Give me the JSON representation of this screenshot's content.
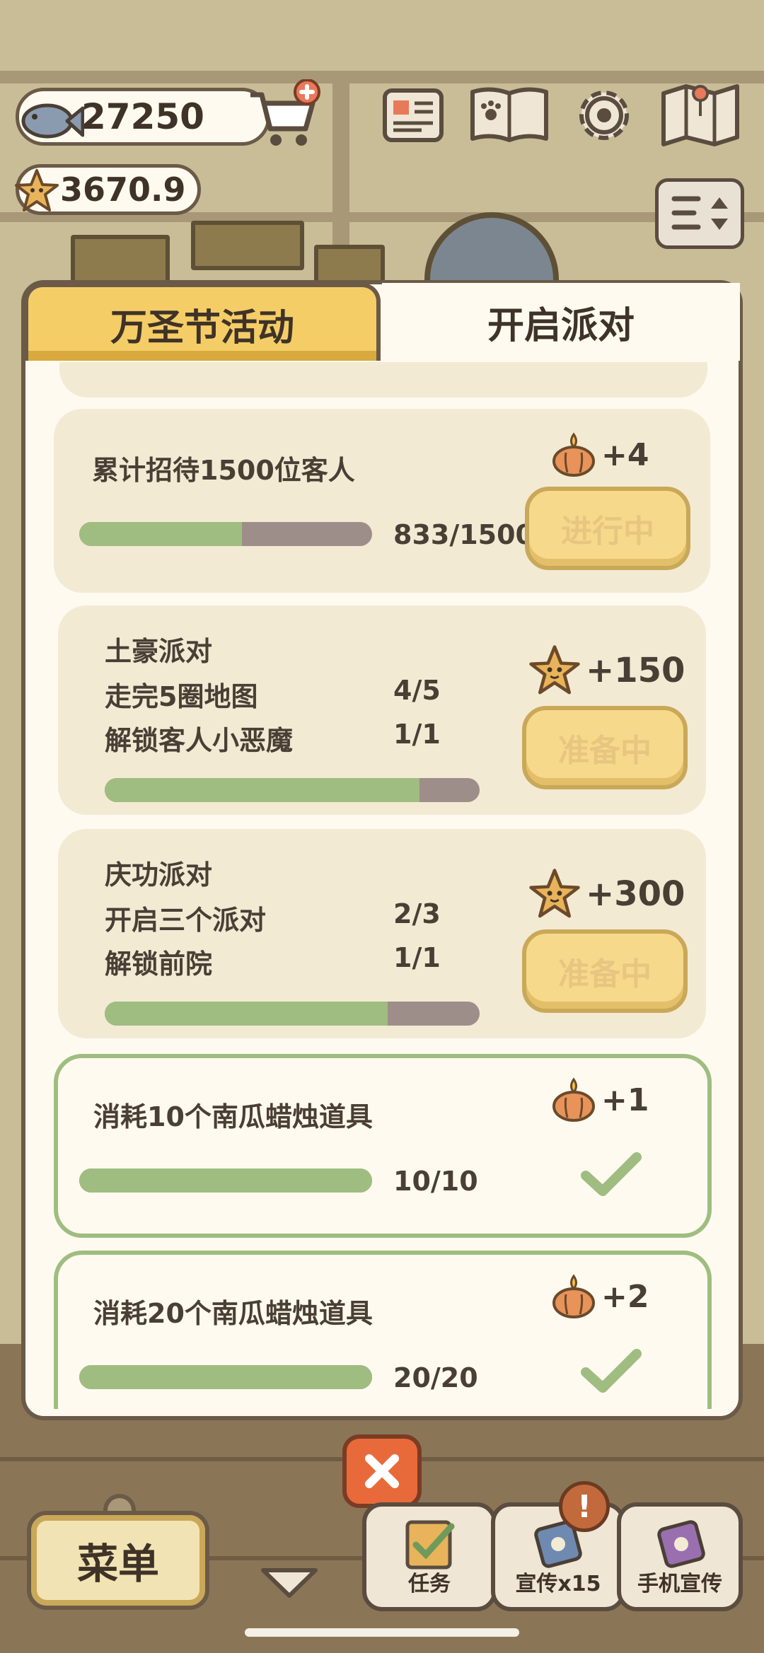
{
  "hud": {
    "fish_count": "27250",
    "star_count": "3670.9",
    "icons": [
      "fish-icon",
      "cart-plus-icon",
      "newspaper-icon",
      "pawprint-book-icon",
      "gear-icon",
      "map-icon",
      "sort-icon"
    ]
  },
  "tabs": [
    {
      "label": "万圣节活动",
      "active": true
    },
    {
      "label": "开启派对",
      "active": false
    }
  ],
  "tasks": [
    {
      "title": "累计招待1500位客人",
      "reward_icon": "pumpkin-candle-icon",
      "reward": "+4",
      "progress_text": "833/1500",
      "progress": 0.555,
      "state": "进行中"
    },
    {
      "title": "土豪派对",
      "lines": [
        {
          "label": "走完5圈地图",
          "count": "4/5"
        },
        {
          "label": "解锁客人小恶魔",
          "count": "1/1"
        }
      ],
      "reward_icon": "star-face-icon",
      "reward": "+150",
      "progress": 0.84,
      "state": "准备中"
    },
    {
      "title": "庆功派对",
      "lines": [
        {
          "label": "开启三个派对",
          "count": "2/3"
        },
        {
          "label": "解锁前院",
          "count": "1/1"
        }
      ],
      "reward_icon": "star-face-icon",
      "reward": "+300",
      "progress": 0.755,
      "state": "准备中"
    },
    {
      "title": "消耗10个南瓜蜡烛道具",
      "reward_icon": "pumpkin-candle-icon",
      "reward": "+1",
      "progress_text": "10/10",
      "progress": 1.0,
      "state": "done"
    },
    {
      "title": "消耗20个南瓜蜡烛道具",
      "reward_icon": "pumpkin-candle-icon",
      "reward": "+2",
      "progress_text": "20/20",
      "progress": 1.0,
      "state": "done"
    }
  ],
  "bottom": {
    "menu_label": "菜单",
    "task_label": "任务",
    "promo_label": "宣传x15",
    "phone_promo_label": "手机宣传",
    "badge_text": "!"
  },
  "colors": {
    "progress_fill": "#9fbd80",
    "progress_track": "#9d8e8a",
    "tab_active": "#f5cd67",
    "close_button": "#e86a3a"
  }
}
